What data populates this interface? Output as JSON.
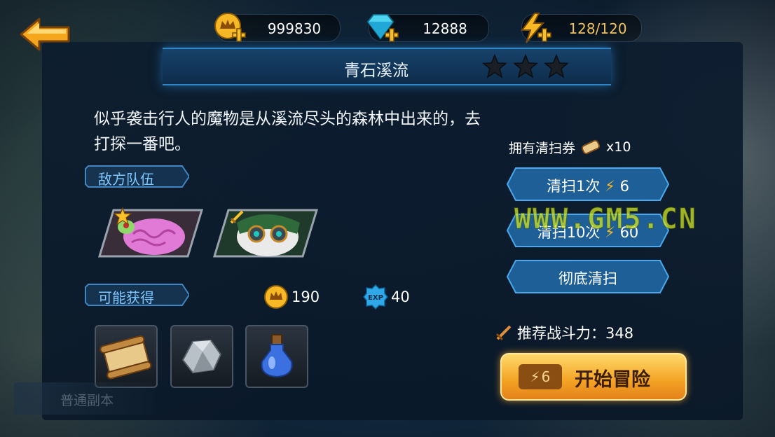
{
  "resources": {
    "gold": "999830",
    "gems": "12888",
    "energy": "128/120"
  },
  "stage": {
    "title": "青石溪流",
    "stars": 3,
    "description": "似乎袭击行人的魔物是从溪流尽头的森林中出来的，去打探一番吧。"
  },
  "sections": {
    "enemy_team": "敌方队伍",
    "possible_rewards": "可能获得"
  },
  "rewards": {
    "gold": "190",
    "exp_badge": "EXP",
    "exp": "40"
  },
  "sweep": {
    "ticket_label": "拥有清扫券",
    "ticket_count": "x10",
    "sweep_once": "清扫1次",
    "sweep_once_cost": "6",
    "sweep_ten": "清扫10次",
    "sweep_ten_cost": "60",
    "sweep_all": "彻底清扫"
  },
  "recommended_power": "推荐战斗力：348",
  "start": {
    "cost": "6",
    "label": "开始冒险"
  },
  "watermark": "WWW.GM5.CN",
  "side_tab": "普通副本",
  "colors": {
    "accent_blue": "#2e86c8",
    "gold": "#f3a224",
    "energy_text": "#f2c25a"
  }
}
